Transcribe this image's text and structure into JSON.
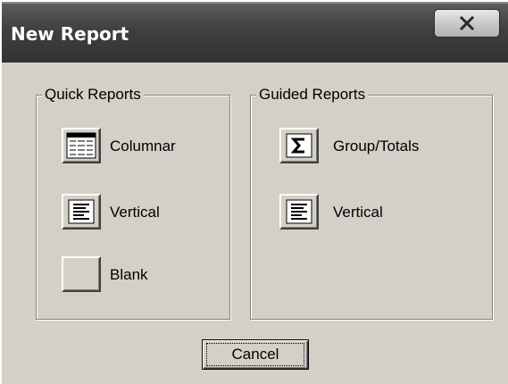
{
  "window": {
    "title": "New Report"
  },
  "quick_reports": {
    "legend": "Quick Reports",
    "items": [
      {
        "label": "Columnar",
        "icon": "columnar-table-icon"
      },
      {
        "label": "Vertical",
        "icon": "vertical-lines-icon"
      },
      {
        "label": "Blank",
        "icon": "blank-icon"
      }
    ]
  },
  "guided_reports": {
    "legend": "Guided Reports",
    "items": [
      {
        "label": "Group/Totals",
        "icon": "sigma-icon"
      },
      {
        "label": "Vertical",
        "icon": "vertical-lines-icon"
      }
    ]
  },
  "footer": {
    "cancel_label": "Cancel"
  }
}
